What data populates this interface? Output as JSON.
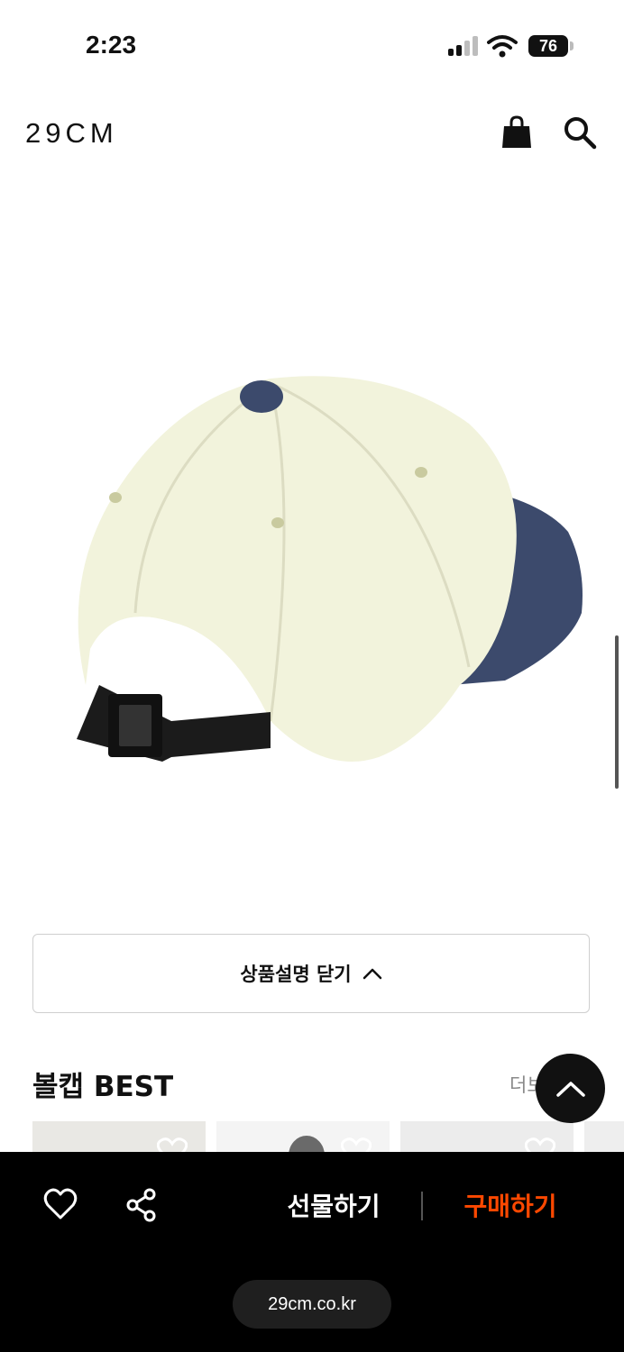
{
  "status_bar": {
    "time": "2:23",
    "battery": "76"
  },
  "header": {
    "logo": "29CM",
    "icons": [
      "shopping-bag-icon",
      "search-icon"
    ]
  },
  "product": {
    "image_icon": "ball-cap-image",
    "colors": {
      "crown": "#f2f3dc",
      "brim": "#3c4a6c",
      "button": "#3c4a6c",
      "strap": "#1b1b1b"
    }
  },
  "description_toggle": {
    "label": "상품설명 닫기"
  },
  "best_section": {
    "title": "볼캡 BEST",
    "more_label": "더보기"
  },
  "bottom_bar": {
    "gift_label": "선물하기",
    "buy_label": "구매하기",
    "buy_color": "#ff4800"
  },
  "browser": {
    "url": "29cm.co.kr"
  }
}
